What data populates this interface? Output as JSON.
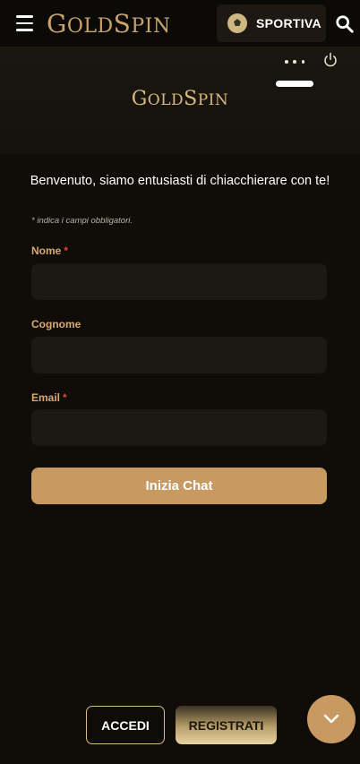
{
  "topbar": {
    "brand": "GOLDSPIN",
    "sport_button": "SPORTIVA",
    "accent": "#c9a36a"
  },
  "chat": {
    "brand": "GOLDSPIN",
    "welcome": "Benvenuto, siamo entusiasti di chiacchierare con te!",
    "required_note": "* indica i campi obbligatori.",
    "fields": [
      {
        "label": "Nome",
        "required": true,
        "value": ""
      },
      {
        "label": "Cognome",
        "required": false,
        "value": ""
      },
      {
        "label": "Email",
        "required": true,
        "value": ""
      }
    ],
    "required_marker": "*",
    "start_button": "Inizia Chat",
    "button_color": "#c89a61"
  },
  "bottom": {
    "login": "ACCEDI",
    "register": "REGISTRATI"
  }
}
